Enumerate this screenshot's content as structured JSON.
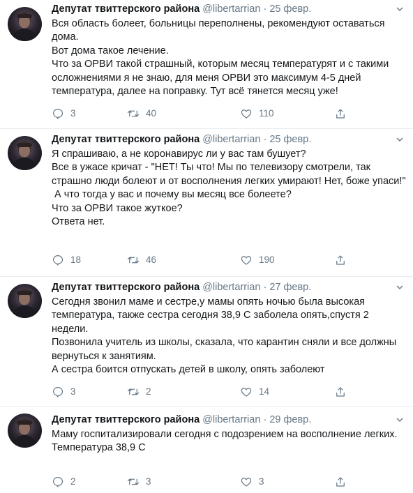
{
  "tweets": [
    {
      "name": "Депутат твиттерского района",
      "handle": "@libertarrian",
      "date": "25 февр.",
      "lines": [
        "Вся область болеет, больницы переполнены, рекомендуют оставаться дома.",
        "Вот дома такое лечение.",
        "Что за ОРВИ такой страшный, которым месяц температурят и с такими осложнениями я не знаю, для меня ОРВИ это максимум 4-5 дней температура, далее на поправку. Тут всё тянется месяц уже!"
      ],
      "replies": "3",
      "retweets": "40",
      "likes": "110"
    },
    {
      "name": "Депутат твиттерского района",
      "handle": "@libertarrian",
      "date": "25 февр.",
      "lines": [
        "Я спрашиваю, а не коронавирус ли у вас там бушует?",
        "Все в ужасе кричат - \"НЕТ! Ты что! Мы по телевизору смотрели, так страшно люди болеют и от восполнения легких умирают! Нет, боже упаси!\"",
        " А что тогда у вас и почему вы месяц все болеете?",
        "Что за ОРВИ такое жуткое?",
        "Ответа нет."
      ],
      "replies": "18",
      "retweets": "46",
      "likes": "190"
    },
    {
      "name": "Депутат твиттерского района",
      "handle": "@libertarrian",
      "date": "27 февр.",
      "lines": [
        "Сегодня звонил маме и сестре,у мамы опять ночью была высокая температура, также сестра сегодня 38,9 С заболела опять,спустя 2 недели.",
        "Позвонила учитель из школы, сказала, что карантин сняли и все должны вернуться к занятиям.",
        "А сестра боится отпускать детей в школу, опять заболеют"
      ],
      "replies": "3",
      "retweets": "2",
      "likes": "14"
    },
    {
      "name": "Депутат твиттерского района",
      "handle": "@libertarrian",
      "date": "29 февр.",
      "lines": [
        "Маму госпитализировали сегодня с подозрением на восполнение легких.",
        "Температура 38,9 С"
      ],
      "replies": "2",
      "retweets": "3",
      "likes": "3"
    }
  ],
  "separator": "·",
  "icons": {
    "reply": "reply-icon",
    "retweet": "retweet-icon",
    "like": "heart-icon",
    "share": "share-icon",
    "menu": "chevron-down-icon"
  },
  "colors": {
    "text": "#14171a",
    "secondary": "#657786",
    "border": "#e6ecf0"
  }
}
